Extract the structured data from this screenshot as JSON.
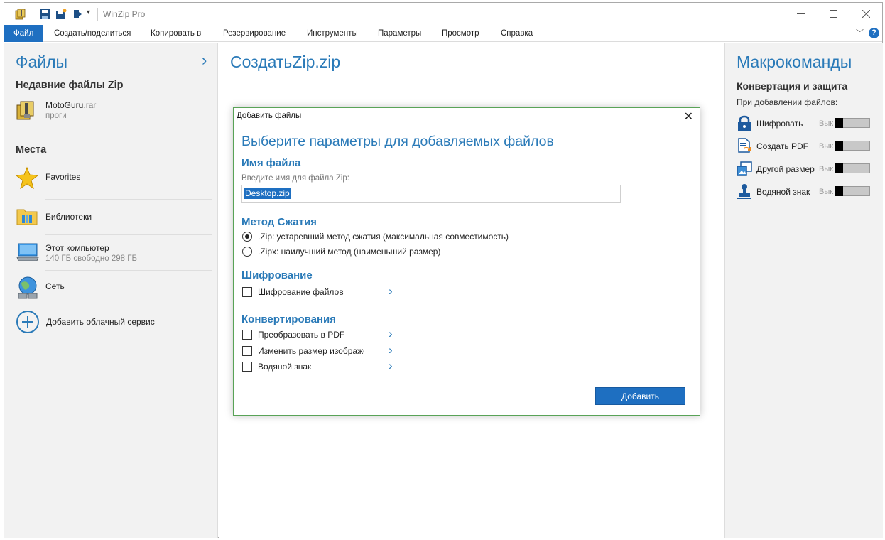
{
  "window": {
    "title": "WinZip Pro"
  },
  "ribbon": {
    "tabs": [
      "Файл",
      "Создать/поделиться",
      "Копировать в",
      "Резервирование",
      "Инструменты",
      "Параметры",
      "Просмотр",
      "Справка"
    ],
    "active_tab": "Файл",
    "help_label": "?"
  },
  "left": {
    "title": "Файлы",
    "recent_heading": "Недавние файлы Zip",
    "recent_files": [
      {
        "name": "MotoGuru",
        "ext": ".rar",
        "folder": "проги"
      }
    ],
    "places_heading": "Места",
    "places": [
      {
        "label": "Favorites",
        "icon": "star-icon"
      },
      {
        "label": "Библиотеки",
        "icon": "library-folder-icon"
      },
      {
        "label": "Этот компьютер",
        "sub": "140 ГБ свободно 298 ГБ",
        "icon": "computer-icon"
      },
      {
        "label": "Сеть",
        "icon": "network-globe-icon"
      }
    ],
    "add_cloud": "Добавить облачный сервис"
  },
  "center": {
    "zip_name": "СоздатьZip.zip"
  },
  "right": {
    "title": "Макрокоманды",
    "subtitle": "Конвертация и защита",
    "on_add": "При добавлении файлов:",
    "macros": [
      {
        "label": "Шифровать",
        "state": "Вык",
        "icon": "lock-icon"
      },
      {
        "label": "Создать PDF",
        "state": "Вык",
        "icon": "pdf-convert-icon"
      },
      {
        "label": "Другой размер",
        "state": "Вык",
        "icon": "resize-image-icon"
      },
      {
        "label": "Водяной знак",
        "state": "Вык",
        "icon": "stamp-icon"
      }
    ]
  },
  "dialog": {
    "title": "Добавить файлы",
    "close_glyph": "✕",
    "heading": "Выберите параметры для добавляемых файлов",
    "filename_section": "Имя файла",
    "filename_hint": "Введите имя для файла Zip:",
    "filename_value": "Desktop.zip",
    "compression_section": "Метод Сжатия",
    "compression_options": [
      {
        "label": ".Zip: устаревший метод сжатия (максимальная совместимость)",
        "checked": true
      },
      {
        "label": ".Zipx: наилучший метод (наименьший размер)",
        "checked": false
      }
    ],
    "encryption_section": "Шифрование",
    "encryption_option": "Шифрование файлов",
    "conversion_section": "Конвертирования",
    "conversion_options": [
      "Преобразовать в PDF",
      "Изменить размер изображений",
      "Водяной знак"
    ],
    "add_button": "Добавить"
  }
}
